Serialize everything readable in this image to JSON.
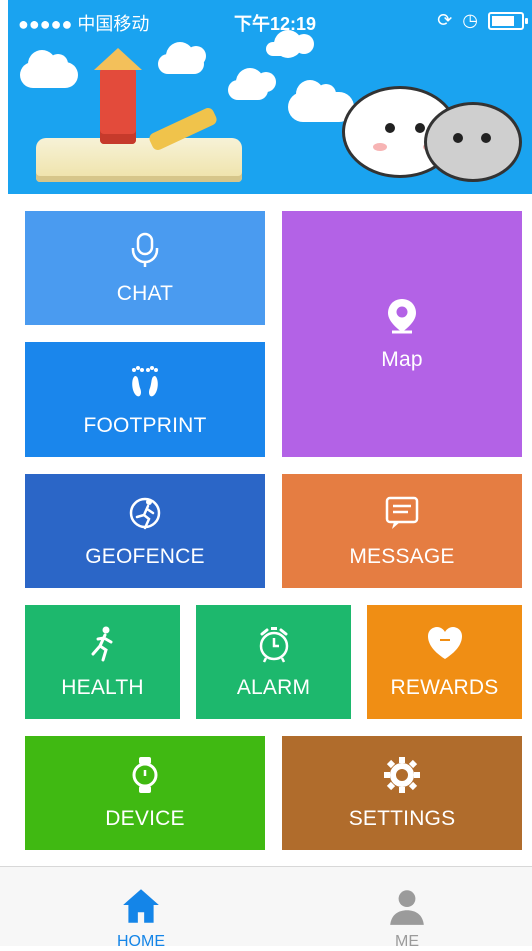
{
  "status_bar": {
    "carrier": "●●●●● 中国移动",
    "time": "下午12:19"
  },
  "tiles": {
    "chat": "CHAT",
    "map": "Map",
    "footprint": "FOOTPRINT",
    "geofence": "GEOFENCE",
    "message": "MESSAGE",
    "health": "HEALTH",
    "alarm": "ALARM",
    "rewards": "REWARDS",
    "device": "DEVICE",
    "settings": "SETTINGS"
  },
  "colors": {
    "banner": "#1aa3f0",
    "chat": "#4a9bf0",
    "map": "#b362e6",
    "footprint": "#1a86ec",
    "geofence": "#2b66c7",
    "message": "#e57d42",
    "health": "#1db86d",
    "alarm": "#1db86d",
    "rewards": "#f08e14",
    "device": "#40b912",
    "settings": "#b06c2c",
    "nav_active": "#1485e8",
    "nav_inactive": "#9b9b9b"
  },
  "bottom_nav": {
    "home": "HOME",
    "me": "ME"
  }
}
